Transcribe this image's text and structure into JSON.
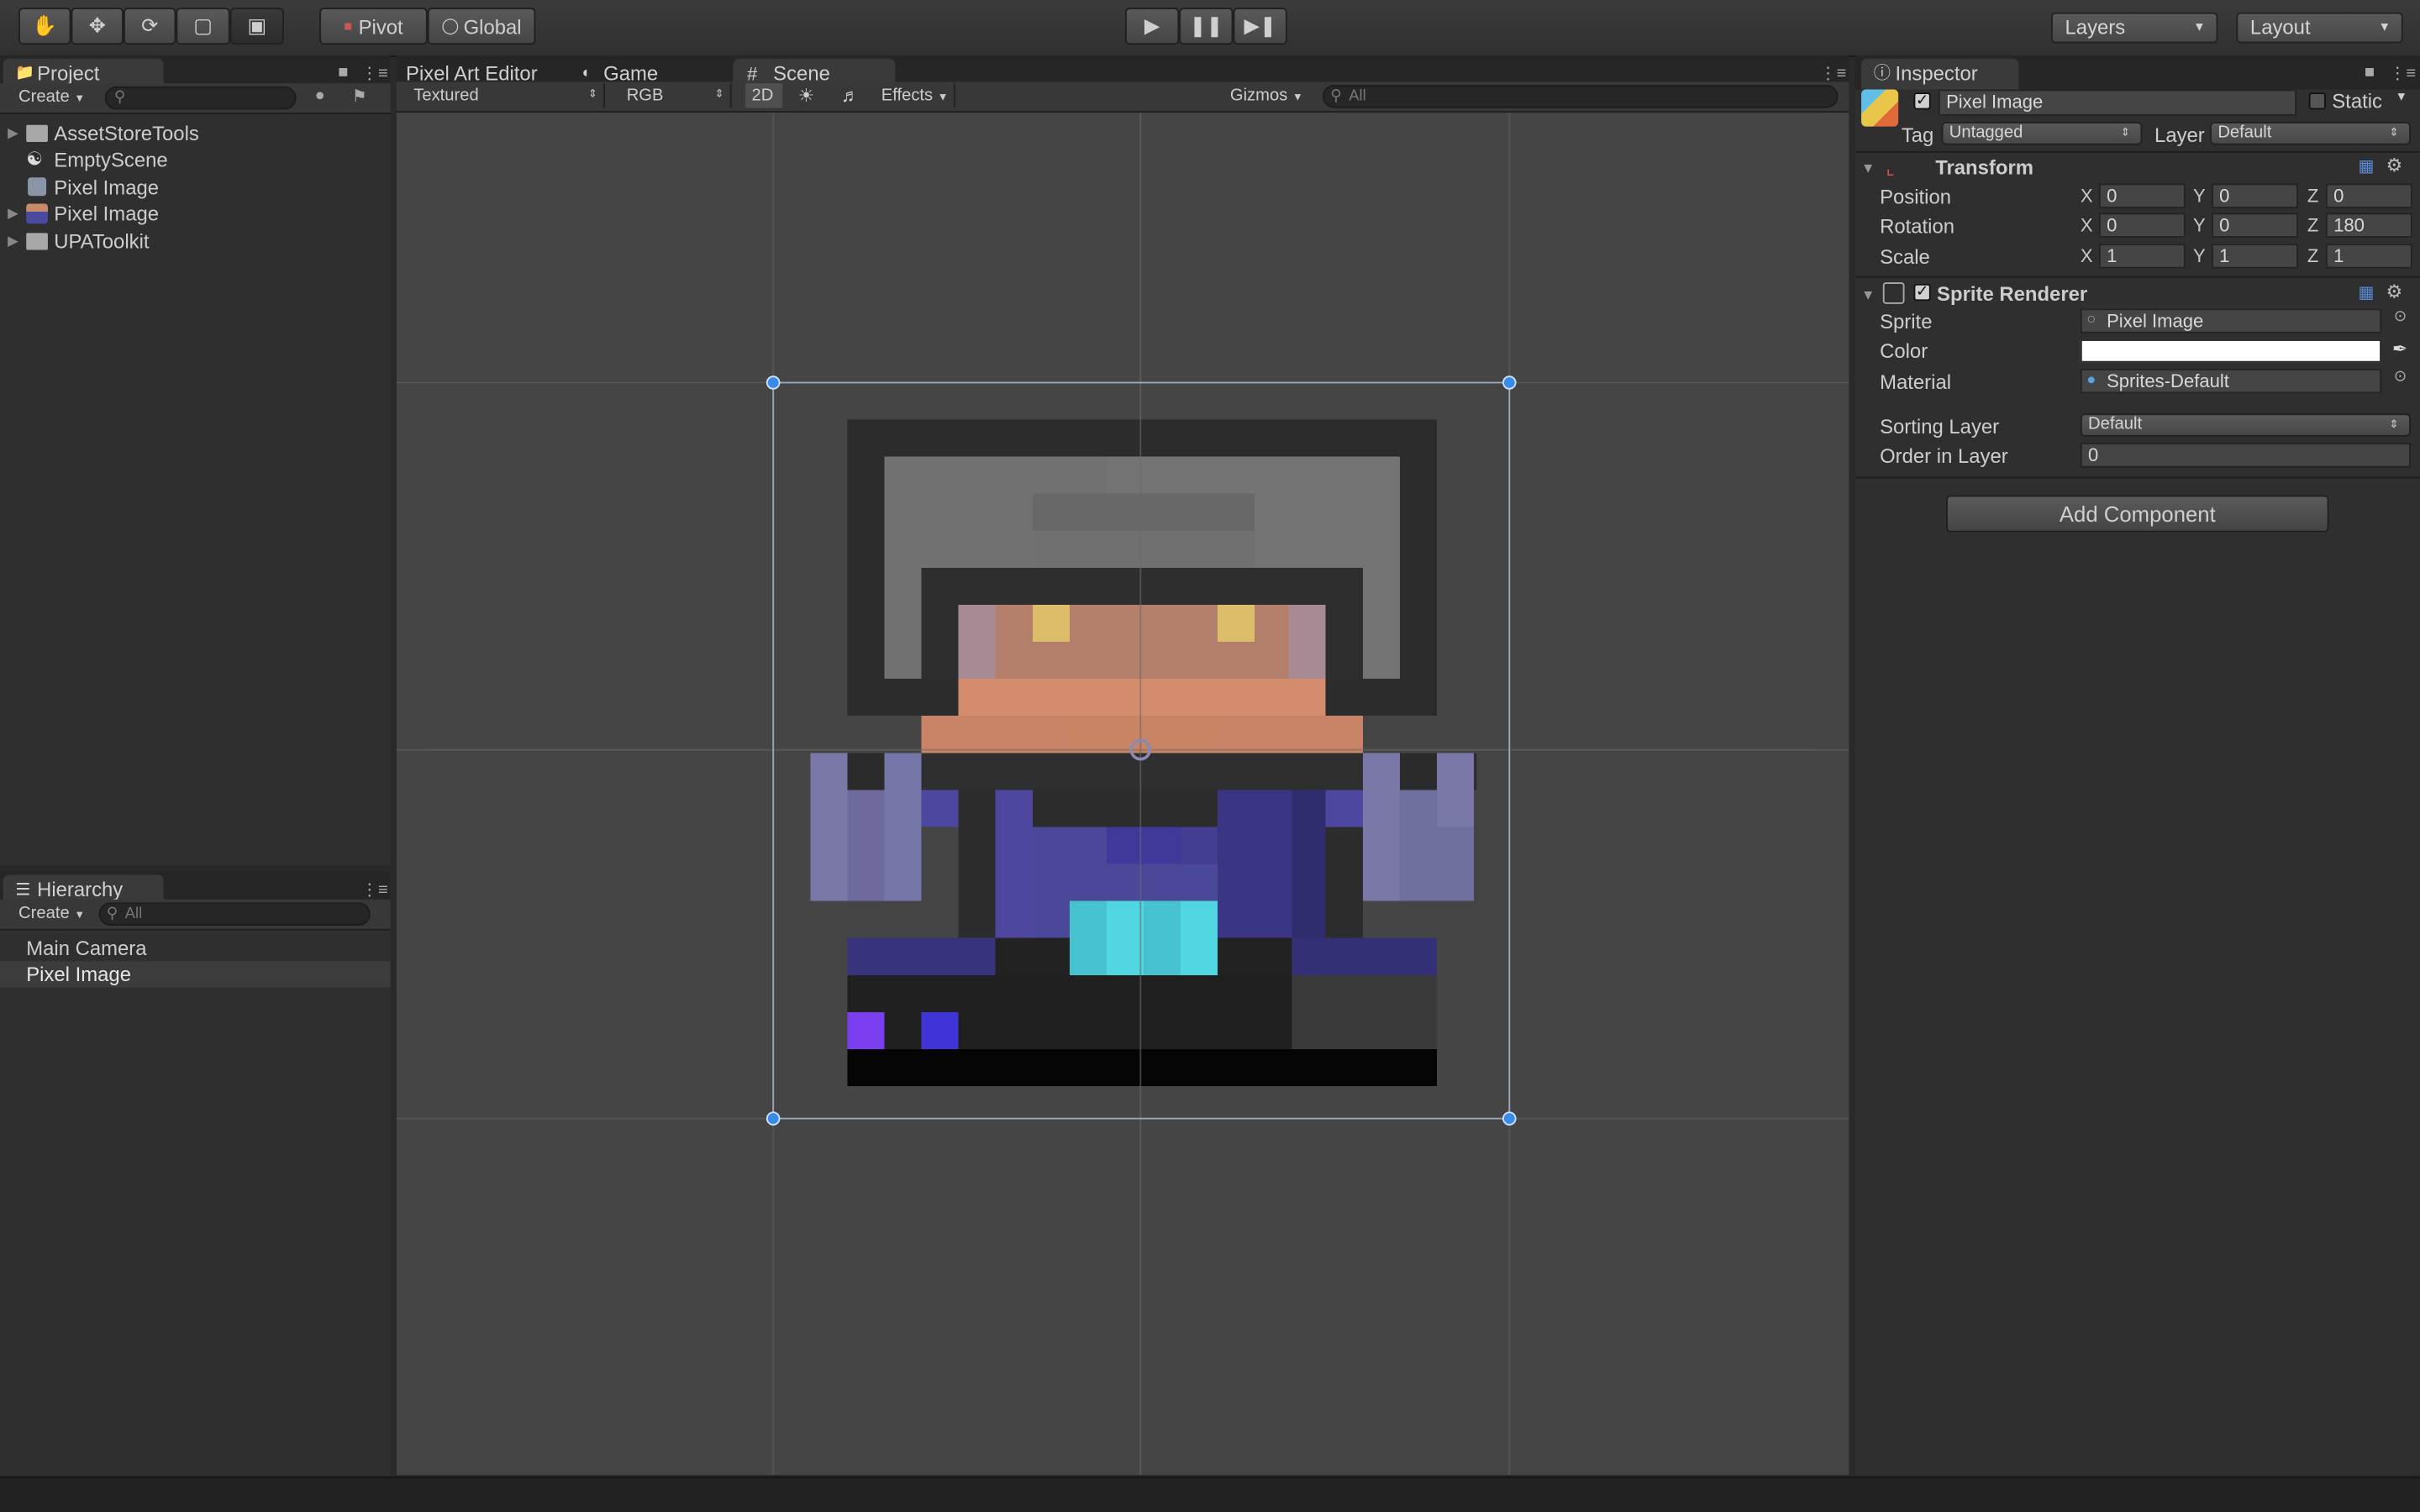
{
  "toolbar": {
    "tools": [
      "hand-tool-icon",
      "move-tool-icon",
      "rotate-tool-icon",
      "scale-tool-icon",
      "rect-tool-icon"
    ],
    "pivot_label": "Pivot",
    "global_label": "Global",
    "layers_label": "Layers",
    "layout_label": "Layout"
  },
  "project": {
    "tab": "Project",
    "create_label": "Create",
    "items": [
      {
        "label": "AssetStoreTools",
        "kind": "folder"
      },
      {
        "label": "EmptyScene",
        "kind": "scene"
      },
      {
        "label": "Pixel Image",
        "kind": "asset"
      },
      {
        "label": "Pixel Image",
        "kind": "sprite"
      },
      {
        "label": "UPAToolkit",
        "kind": "folder"
      }
    ]
  },
  "hierarchy": {
    "tab": "Hierarchy",
    "create_label": "Create",
    "search_placeholder": "All",
    "items": [
      "Main Camera",
      "Pixel Image"
    ]
  },
  "center": {
    "tabs": [
      "Pixel Art Editor",
      "Game",
      "Scene"
    ],
    "shading": "Textured",
    "channel": "RGB",
    "mode_2d": "2D",
    "effects": "Effects",
    "gizmos": "Gizmos",
    "search_placeholder": "All"
  },
  "inspector": {
    "tab": "Inspector",
    "object_name": "Pixel Image",
    "static_label": "Static",
    "tag_label": "Tag",
    "tag_value": "Untagged",
    "layer_label": "Layer",
    "layer_value": "Default",
    "transform": {
      "title": "Transform",
      "position_label": "Position",
      "position": [
        "0",
        "0",
        "0"
      ],
      "rotation_label": "Rotation",
      "rotation": [
        "0",
        "0",
        "180"
      ],
      "scale_label": "Scale",
      "scale": [
        "1",
        "1",
        "1"
      ]
    },
    "sprite_renderer": {
      "title": "Sprite Renderer",
      "sprite_label": "Sprite",
      "sprite_value": "Pixel Image",
      "color_label": "Color",
      "color_value": "#ffffff",
      "material_label": "Material",
      "material_value": "Sprites-Default",
      "sorting_layer_label": "Sorting Layer",
      "sorting_layer_value": "Default",
      "order_label": "Order in Layer",
      "order_value": "0"
    },
    "add_component": "Add Component"
  },
  "axes": {
    "x": "X",
    "y": "Y",
    "z": "Z"
  },
  "colors": {
    "panel_bg": "#2f2f2f",
    "scene_bg": "#454545",
    "selection_handle": "#3a8be8"
  }
}
